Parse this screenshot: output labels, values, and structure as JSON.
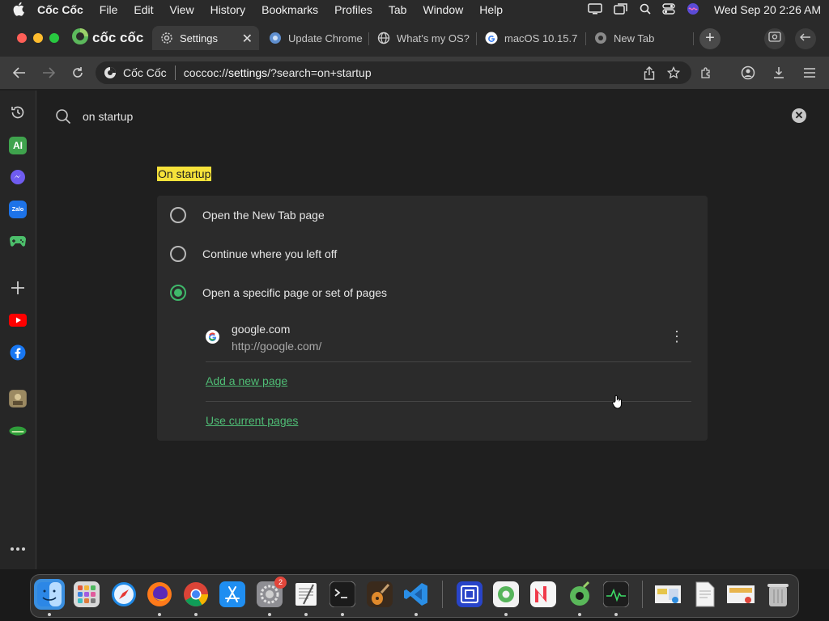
{
  "menubar": {
    "app_name": "Cốc Cốc",
    "items": [
      "File",
      "Edit",
      "View",
      "History",
      "Bookmarks",
      "Profiles",
      "Tab",
      "Window",
      "Help"
    ],
    "clock": "Wed Sep 20  2:26 AM"
  },
  "browser": {
    "brand": "cốc cốc",
    "tabs": [
      {
        "label": "Settings",
        "icon": "gear-icon",
        "active": true
      },
      {
        "label": "Update Chrome",
        "icon": "chrome-update-icon",
        "active": false
      },
      {
        "label": "What's my OS?",
        "icon": "globe-icon",
        "active": false
      },
      {
        "label": "macOS 10.15.7",
        "icon": "google-icon",
        "active": false
      },
      {
        "label": "New Tab",
        "icon": "coccoc-icon",
        "active": false
      }
    ],
    "omnibox": {
      "site_label": "Cốc Cốc",
      "url_prefix": "coccoc://",
      "url_host": "settings",
      "url_rest": "/?search=on+startup"
    }
  },
  "settings": {
    "search_value": "on startup",
    "section_title": "On startup",
    "options": [
      {
        "label": "Open the New Tab page",
        "checked": false
      },
      {
        "label": "Continue where you left off",
        "checked": false
      },
      {
        "label": "Open a specific page or set of pages",
        "checked": true
      }
    ],
    "startup_page": {
      "name": "google.com",
      "url": "http://google.com/"
    },
    "add_new_page": "Add a new page",
    "use_current_pages": "Use current pages"
  },
  "sidebar": {
    "ai_label": "AI",
    "zalo_label": "Zalo"
  },
  "dock": {
    "settings_badge": "2"
  },
  "colors": {
    "accent": "#3fb86a",
    "highlight": "#f6e23a",
    "link": "#4fbd75"
  }
}
